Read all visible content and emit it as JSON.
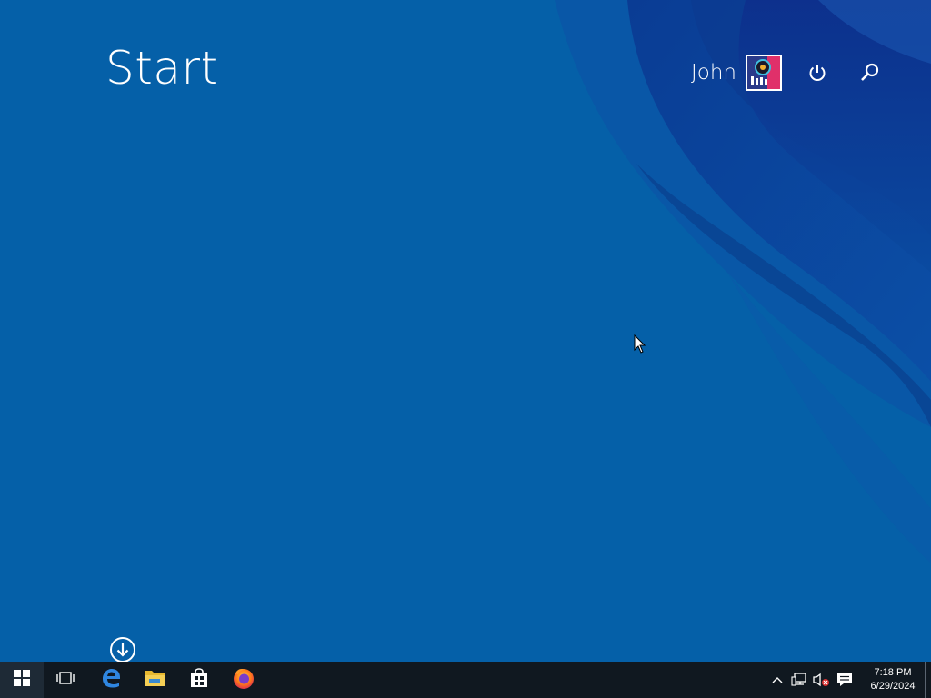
{
  "start_screen": {
    "title": "Start",
    "user_name": "John",
    "background_color": "#0560a8",
    "icons": {
      "power": "power-icon",
      "search": "search-icon",
      "all_apps": "down-arrow-circle-icon"
    }
  },
  "taskbar": {
    "background_color": "#101820",
    "pinned": [
      {
        "name": "start-button",
        "icon": "windows-logo-icon"
      },
      {
        "name": "task-view-button",
        "icon": "task-view-icon"
      },
      {
        "name": "edge-button",
        "icon": "edge-icon"
      },
      {
        "name": "file-explorer-button",
        "icon": "folder-icon"
      },
      {
        "name": "store-button",
        "icon": "store-icon"
      },
      {
        "name": "firefox-button",
        "icon": "firefox-icon"
      }
    ],
    "tray": {
      "icons": [
        "chevron-up-icon",
        "network-icon",
        "volume-muted-icon",
        "action-center-icon"
      ],
      "time": "7:18 PM",
      "date": "6/29/2024"
    }
  }
}
